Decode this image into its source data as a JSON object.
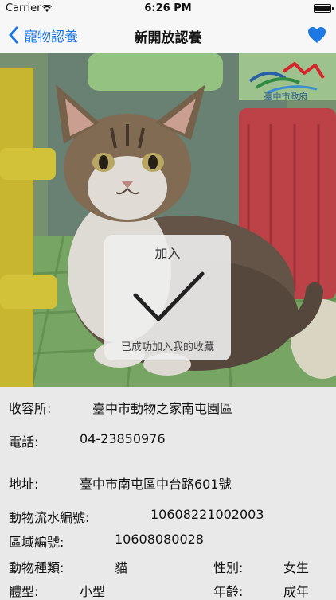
{
  "status_bar": {
    "carrier": "Carrier",
    "time": "6:26 PM"
  },
  "nav": {
    "back_label": "寵物認養",
    "title": "新開放認養"
  },
  "hud": {
    "title": "加入",
    "message": "已成功加入我的收藏"
  },
  "photo": {
    "logo_text": "臺中市政府"
  },
  "info": {
    "shelter_label": "收容所:",
    "shelter_value": "臺中市動物之家南屯園區",
    "phone_label": "電話:",
    "phone_value": "04-23850976",
    "address_label": "地址:",
    "address_value": "臺中市南屯區中台路601號",
    "serial_label": "動物流水編號:",
    "serial_value": "10608221002003",
    "area_label": "區域編號:",
    "area_value": "10608080028",
    "kind_label": "動物種類:",
    "kind_value": "貓",
    "sex_label": "性別:",
    "sex_value": "女生",
    "size_label": "體型:",
    "size_value": "小型",
    "age_label": "年齡:",
    "age_value": "成年"
  },
  "colors": {
    "accent": "#1c78e4",
    "background": "#e9e9ea"
  }
}
